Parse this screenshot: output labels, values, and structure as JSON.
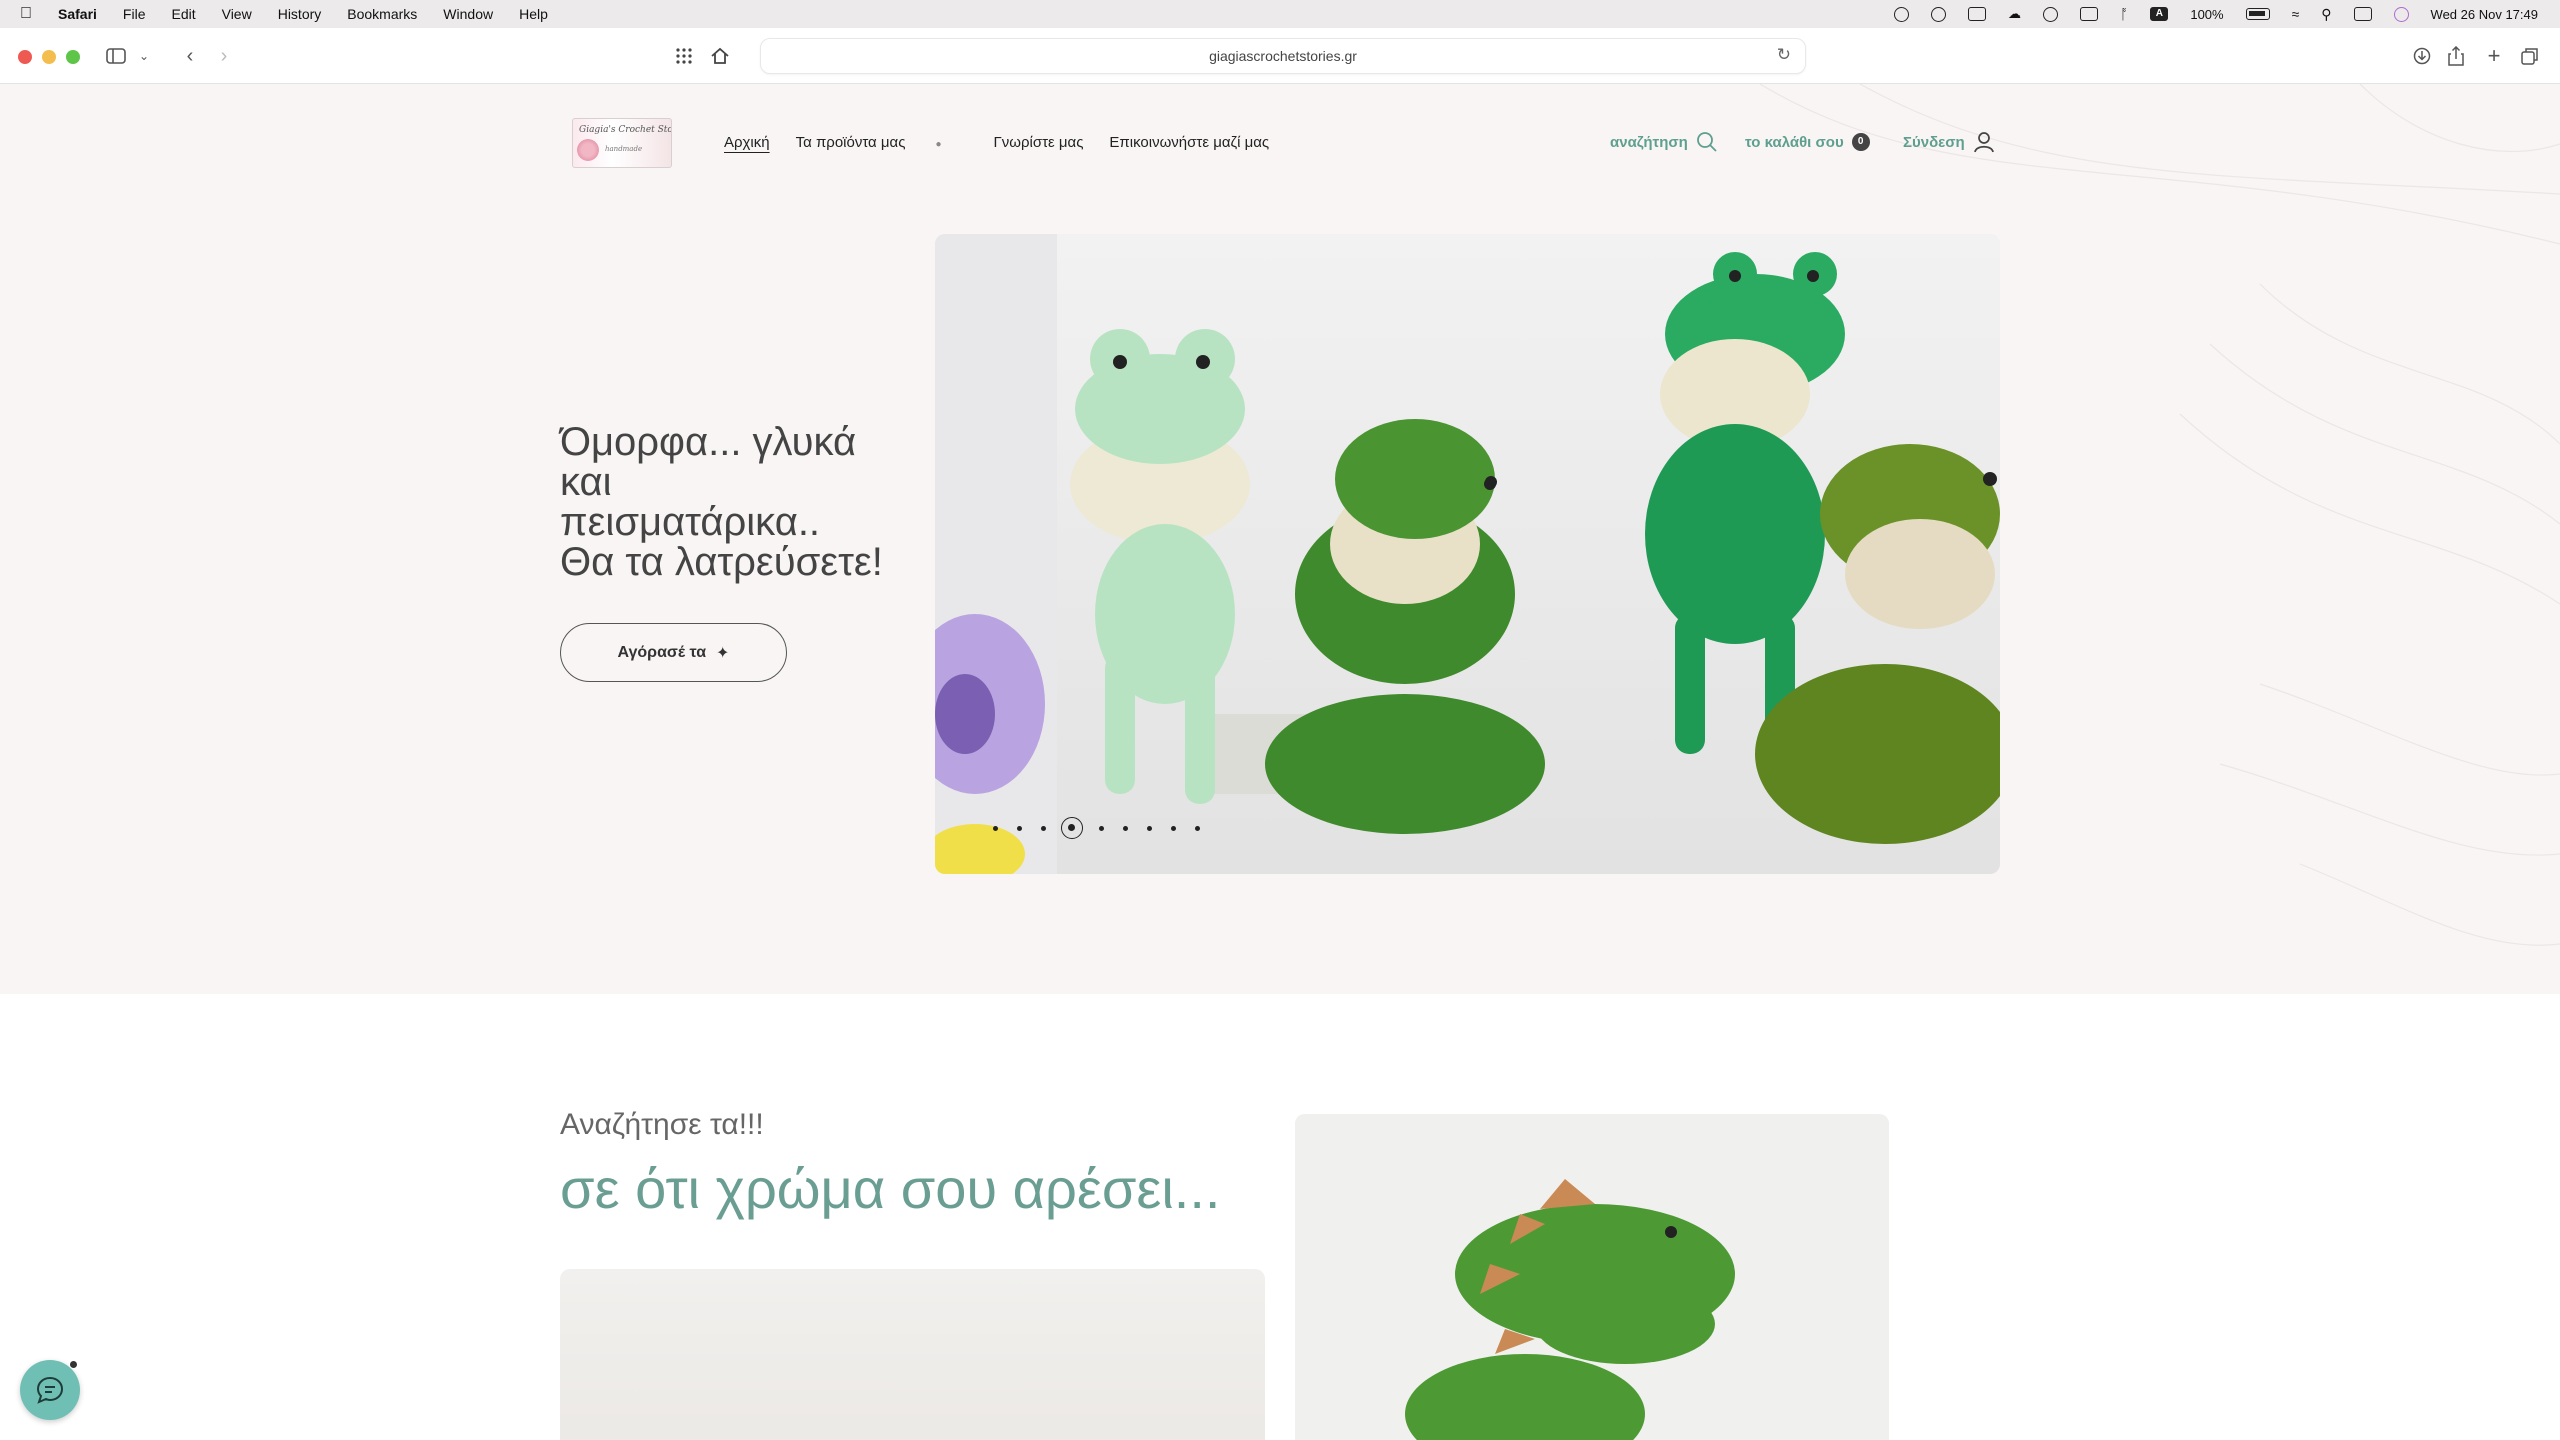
{
  "menubar": {
    "app": "Safari",
    "items": [
      "File",
      "Edit",
      "View",
      "History",
      "Bookmarks",
      "Window",
      "Help"
    ],
    "battery": "100%",
    "input_source": "A",
    "datetime": "Wed 26 Nov  17:49"
  },
  "browser": {
    "url": "giagiascrochetstories.gr"
  },
  "site": {
    "logo_line1": "Giagia's Crochet Stories",
    "logo_line2": "handmade",
    "nav": {
      "home": "Αρχική",
      "products": "Τα προϊόντα μας",
      "about": "Γνωρίστε μας",
      "contact": "Επικοινωνήστε μαζί μας"
    },
    "search_label": "αναζήτηση",
    "cart_label": "το καλάθι σου",
    "cart_count": "0",
    "login_label": "Σύνδεση"
  },
  "hero": {
    "title_line1": "Όμορφα... γλυκά",
    "title_line2": "και",
    "title_line3": "πεισματάρικα..",
    "title_line4": "Θα τα λατρεύσετε!",
    "button_label": "Αγόρασέ τα",
    "slide_count": 9,
    "active_slide": 4
  },
  "section2": {
    "subtitle": "Αναζήτησε τα!!!",
    "title": "σε ότι χρώμα σου αρέσει..."
  },
  "colors": {
    "accent": "#5e9f8f",
    "heading_accent": "#6a9e92",
    "chat_button": "#6fbfb4",
    "hero_bg": "#f9f5f5"
  }
}
